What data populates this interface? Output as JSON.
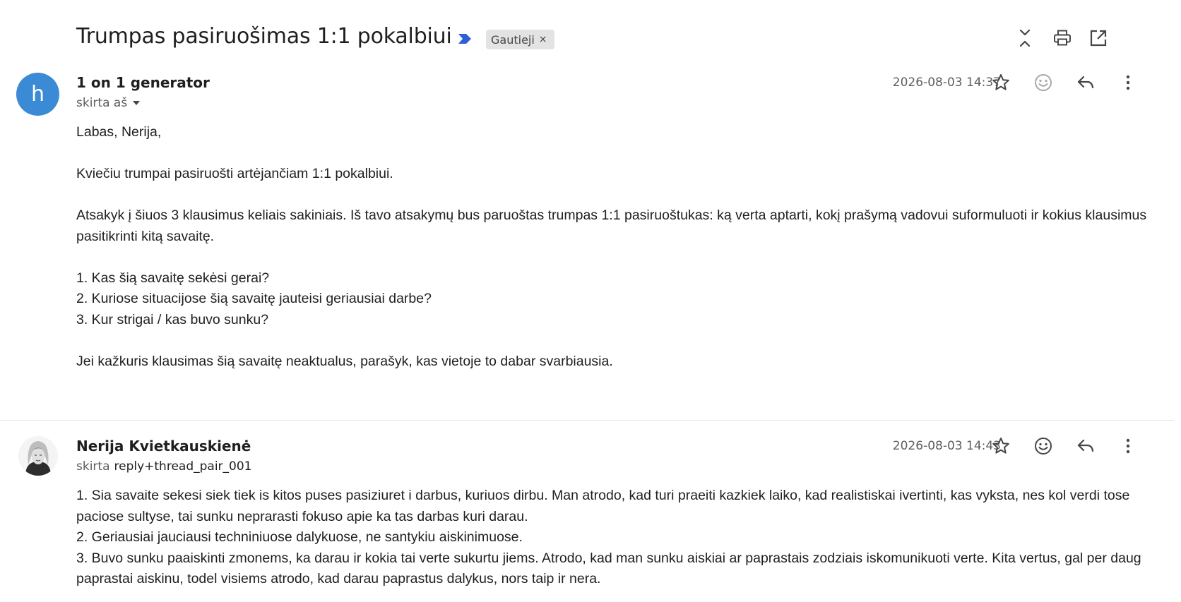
{
  "subject": {
    "title": "Trumpas pasiruošimas 1:1 pokalbiui",
    "label_chip": "Gautieji",
    "label_remove": "×"
  },
  "toolbar": {
    "icons": [
      "collapse-all-icon",
      "print-icon",
      "open-in-new-window-icon"
    ]
  },
  "messages": [
    {
      "avatar_letter": "h",
      "avatar_color": "#3b8ad5",
      "sender": "1 on 1 generator",
      "to_prefix": "skirta aš",
      "timestamp": "2026-08-03 14:37",
      "body": {
        "greeting": "Labas,  Nerija,",
        "intro": "Kviečiu trumpai pasiruošti artėjančiam 1:1 pokalbiui.",
        "instructions": "Atsakyk į šiuos 3 klausimus keliais sakiniais. Iš tavo atsakymų bus paruoštas trumpas 1:1 pasiruoštukas: ką verta aptarti, kokį prašymą vadovui suformuluoti ir kokius klausimus pasitikrinti kitą savaitę.",
        "questions": [
          "1. Kas šią savaitę sekėsi gerai?",
          "2. Kuriose situacijose šią savaitę jauteisi geriausiai darbe?",
          "3. Kur strigai / kas buvo sunku?"
        ],
        "closing": "Jei kažkuris klausimas šią savaitę neaktualus, parašyk, kas vietoje to dabar svarbiausia."
      }
    },
    {
      "sender": "Nerija Kvietkauskienė",
      "to_prefix": "skirta",
      "to_address": "reply+thread_pair_001",
      "timestamp": "2026-08-03 14:43",
      "body": {
        "answers": [
          "1. Sia savaite sekesi siek tiek is kitos puses pasiziuret i darbus, kuriuos dirbu. Man atrodo, kad turi praeiti kazkiek laiko, kad realistiskai ivertinti, kas vyksta, nes kol verdi tose paciose sultyse, tai sunku neprarasti fokuso apie ka tas darbas kuri darau.",
          "2. Geriausiai jauciausi techniniuose dalykuose, ne santykiu aiskinimuose.",
          "3. Buvo sunku paaiskinti zmonems, ka darau ir kokia tai verte sukurtu jiems. Atrodo, kad man sunku aiskiai ar paprastais zodziais iskomunikuoti verte. Kita vertus, gal per daug paprastai aiskinu, todel visiems atrodo, kad darau paprastus dalykus, nors taip ir nera."
        ]
      }
    }
  ],
  "message_actions": [
    "star-icon",
    "emoji-reaction-icon",
    "reply-icon",
    "more-options-icon"
  ],
  "colors": {
    "importance_marker": "#2e5fd6",
    "chip_background": "#e3e3e3",
    "secondary_text": "#5e5e5e"
  }
}
